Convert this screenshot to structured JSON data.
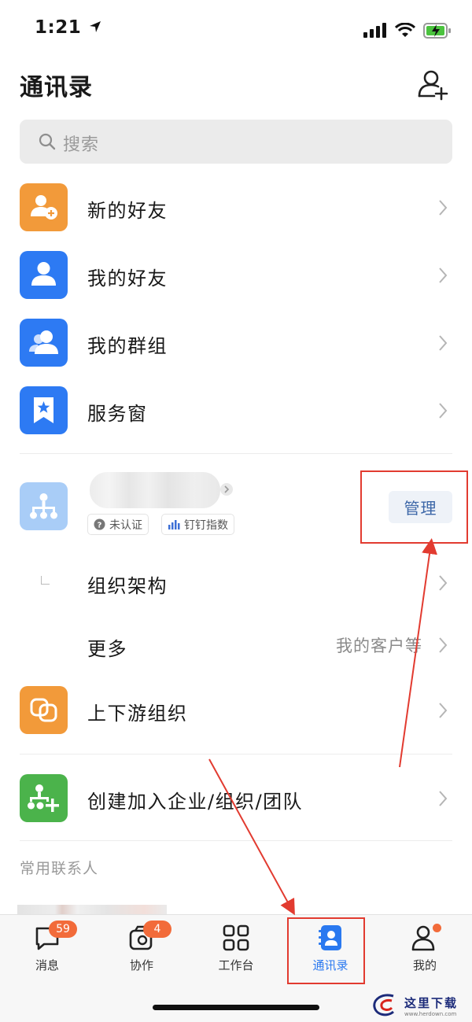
{
  "status": {
    "time": "1:21"
  },
  "header": {
    "title": "通讯录"
  },
  "search": {
    "placeholder": "搜索"
  },
  "items": [
    {
      "label": "新的好友",
      "icon": "add-friend-icon",
      "color": "#f29a3a"
    },
    {
      "label": "我的好友",
      "icon": "person-icon",
      "color": "#2d7af3"
    },
    {
      "label": "我的群组",
      "icon": "group-icon",
      "color": "#2d7af3"
    },
    {
      "label": "服务窗",
      "icon": "bookmark-star-icon",
      "color": "#2d7af3"
    }
  ],
  "org": {
    "badges": [
      "未认证",
      "钉钉指数"
    ],
    "manage_label": "管理",
    "structure_label": "组织架构",
    "more_label": "更多",
    "more_value": "我的客户等"
  },
  "extra_items": [
    {
      "label": "上下游组织",
      "icon": "link-icon",
      "color": "#f29a3a"
    },
    {
      "label": "创建加入企业/组织/团队",
      "icon": "create-org-icon",
      "color": "#4bb34b"
    }
  ],
  "section": {
    "frequent_contacts": "常用联系人"
  },
  "tabs": [
    {
      "label": "消息",
      "icon": "chat-icon",
      "badge": "59"
    },
    {
      "label": "协作",
      "icon": "collab-icon",
      "badge": "4"
    },
    {
      "label": "工作台",
      "icon": "grid-icon",
      "badge": ""
    },
    {
      "label": "通讯录",
      "icon": "contacts-icon",
      "badge": "",
      "active": true
    },
    {
      "label": "我的",
      "icon": "profile-icon",
      "badge": "",
      "dot": true
    }
  ],
  "watermark": {
    "text": "这里下载",
    "url": "www.herdown.com"
  },
  "colors": {
    "accent": "#2a79f0",
    "badge": "#f26b3a",
    "annotation": "#e23b30"
  }
}
